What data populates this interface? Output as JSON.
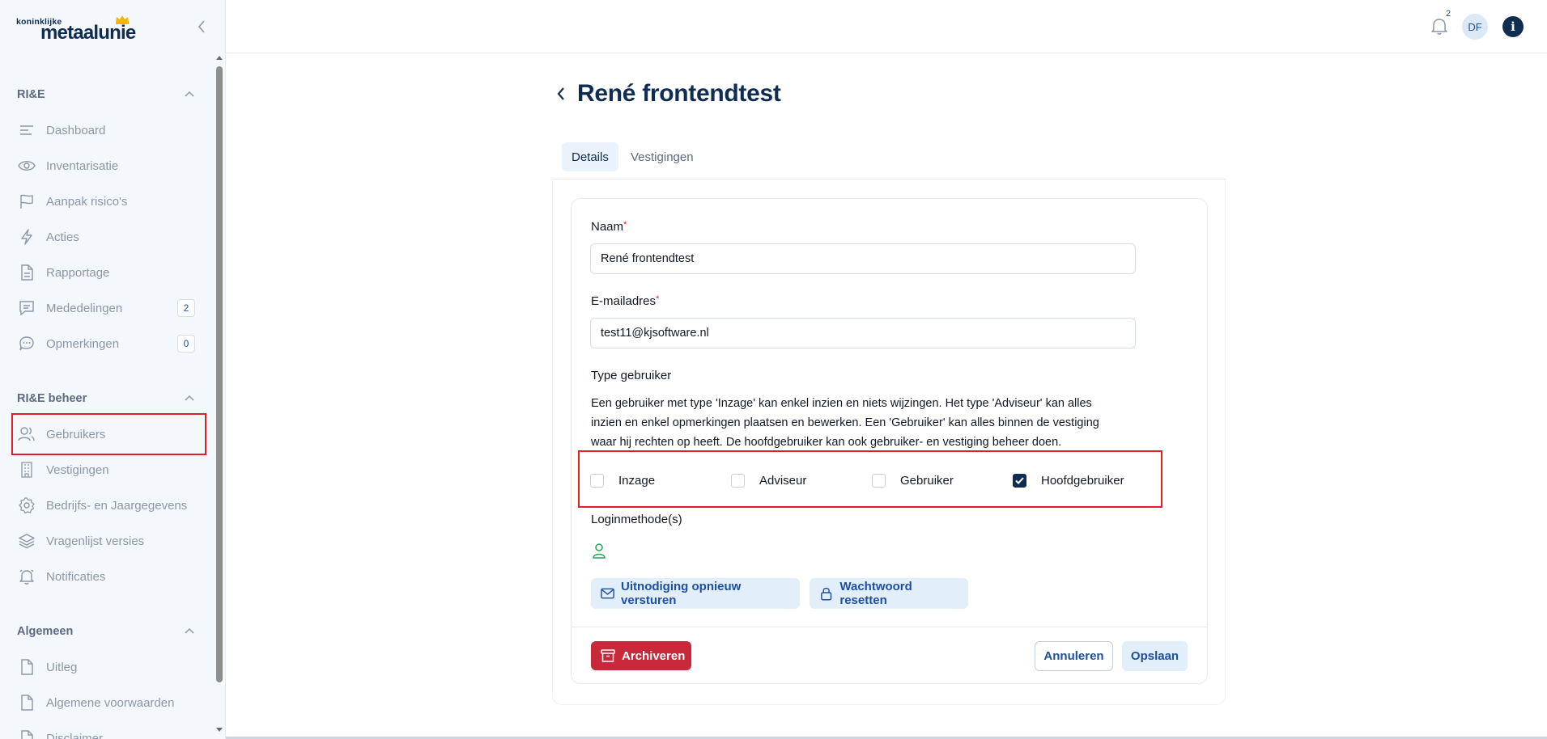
{
  "brand": {
    "line1": "koninklijke",
    "line2": "metaalunie"
  },
  "notifications": {
    "count": "2"
  },
  "user": {
    "initials": "DF"
  },
  "sidebar": {
    "sections": [
      {
        "title": "RI&E",
        "items": [
          {
            "label": "Dashboard",
            "icon": "dashboard-icon"
          },
          {
            "label": "Inventarisatie",
            "icon": "eye-icon"
          },
          {
            "label": "Aanpak risico's",
            "icon": "flag-icon"
          },
          {
            "label": "Acties",
            "icon": "lightning-icon"
          },
          {
            "label": "Rapportage",
            "icon": "document-icon"
          },
          {
            "label": "Mededelingen",
            "icon": "message-icon",
            "badge": "2"
          },
          {
            "label": "Opmerkingen",
            "icon": "comment-icon",
            "badge": "0"
          }
        ]
      },
      {
        "title": "RI&E beheer",
        "items": [
          {
            "label": "Gebruikers",
            "icon": "users-icon"
          },
          {
            "label": "Vestigingen",
            "icon": "building-icon"
          },
          {
            "label": "Bedrijfs- en Jaargegevens",
            "icon": "gear-icon"
          },
          {
            "label": "Vragenlijst versies",
            "icon": "layers-icon"
          },
          {
            "label": "Notificaties",
            "icon": "bell-icon"
          }
        ]
      },
      {
        "title": "Algemeen",
        "items": [
          {
            "label": "Uitleg",
            "icon": "document-icon"
          },
          {
            "label": "Algemene voorwaarden",
            "icon": "document-icon"
          },
          {
            "label": "Disclaimer",
            "icon": "document-icon"
          }
        ]
      }
    ]
  },
  "page": {
    "title": "René frontendtest",
    "tabs": [
      "Details",
      "Vestigingen"
    ],
    "active_tab": "Details"
  },
  "form": {
    "name": {
      "label": "Naam",
      "required": "*",
      "value": "René frontendtest"
    },
    "email": {
      "label": "E-mailadres",
      "required": "*",
      "value": "test11@kjsoftware.nl"
    },
    "type": {
      "label": "Type gebruiker",
      "help": "Een gebruiker met type 'Inzage' kan enkel inzien en niets wijzingen. Het type 'Adviseur' kan alles inzien en enkel opmerkingen plaatsen en bewerken. Een 'Gebruiker' kan alles binnen de vestiging waar hij rechten op heeft. De hoofdgebruiker kan ook gebruiker- en vestiging beheer doen.",
      "options": [
        {
          "label": "Inzage",
          "checked": false
        },
        {
          "label": "Adviseur",
          "checked": false
        },
        {
          "label": "Gebruiker",
          "checked": false
        },
        {
          "label": "Hoofdgebruiker",
          "checked": true
        }
      ]
    },
    "login": {
      "label": "Loginmethode(s)",
      "icon": "user-icon"
    },
    "resend_label": "Uitnodiging opnieuw versturen",
    "reset_label": "Wachtwoord resetten",
    "archive_label": "Archiveren",
    "cancel_label": "Annuleren",
    "save_label": "Opslaan"
  },
  "colors": {
    "primary": "#0f2d52",
    "accent": "#1e4fa0",
    "danger": "#c8283a",
    "highlight": "#e11d2a"
  }
}
